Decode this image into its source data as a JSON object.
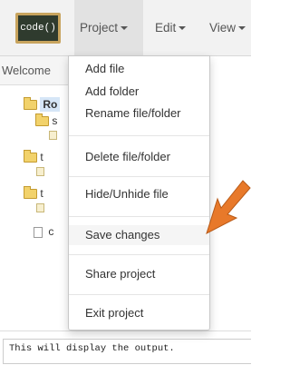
{
  "app": {
    "logo_text": "code()"
  },
  "navbar": {
    "project_label": "Project",
    "edit_label": "Edit",
    "view_label": "View"
  },
  "sidebar": {
    "welcome_text": "Welcome",
    "root_label": "Ro",
    "folders": [
      "s",
      "t",
      "t"
    ],
    "file_label": "c"
  },
  "project_menu": {
    "items": [
      "Add file",
      "Add folder",
      "Rename file/folder",
      "Delete file/folder",
      "Hide/Unhide file",
      "Save changes",
      "Share project",
      "Exit project"
    ]
  },
  "output": {
    "text": "This will display the output."
  },
  "colors": {
    "arrow": "#e8792a",
    "navbar": "#f2f2f2",
    "root_highlight": "#d6e6f7"
  }
}
